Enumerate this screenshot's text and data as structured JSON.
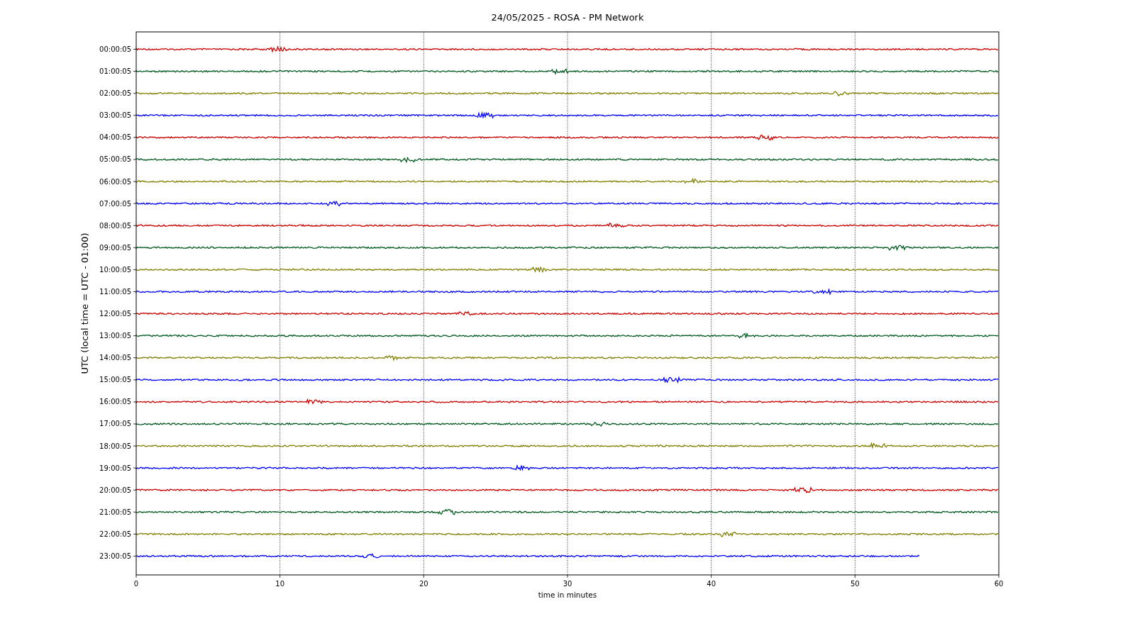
{
  "chart": {
    "title": "24/05/2025 - ROSA - PM Network",
    "ylabel": "UTC (local time = UTC - 01:00)",
    "xlabel": "time in minutes",
    "xticks": [
      "0",
      "10",
      "20",
      "30",
      "40",
      "50",
      "60"
    ],
    "rows": [
      {
        "label": "00:00:05",
        "color": "#cc0000",
        "level": 1
      },
      {
        "label": "01:00:05",
        "color": "#005a1e",
        "level": 1
      },
      {
        "label": "02:00:05",
        "color": "#808000",
        "level": 1
      },
      {
        "label": "03:00:05",
        "color": "#0000ff",
        "level": 1
      },
      {
        "label": "04:00:05",
        "color": "#cc0000",
        "level": 1
      },
      {
        "label": "05:00:05",
        "color": "#005a1e",
        "level": 1
      },
      {
        "label": "06:00:05",
        "color": "#808000",
        "level": 1
      },
      {
        "label": "07:00:05",
        "color": "#0000ff",
        "level": 1
      },
      {
        "label": "08:00:05",
        "color": "#cc0000",
        "level": 1
      },
      {
        "label": "09:00:05",
        "color": "#005a1e",
        "level": 1
      },
      {
        "label": "10:00:05",
        "color": "#808000",
        "level": 1
      },
      {
        "label": "11:00:05",
        "color": "#0000ff",
        "level": 1
      },
      {
        "label": "12:00:05",
        "color": "#cc0000",
        "level": 1
      },
      {
        "label": "13:00:05",
        "color": "#005a1e",
        "level": 1
      },
      {
        "label": "14:00:05",
        "color": "#808000",
        "level": 1
      },
      {
        "label": "15:00:05",
        "color": "#0000ff",
        "level": 1
      },
      {
        "label": "16:00:05",
        "color": "#cc0000",
        "level": 1
      },
      {
        "label": "17:00:05",
        "color": "#005a1e",
        "level": 1
      },
      {
        "label": "18:00:05",
        "color": "#808000",
        "level": 1
      },
      {
        "label": "19:00:05",
        "color": "#0000ff",
        "level": 1
      },
      {
        "label": "20:00:05",
        "color": "#cc0000",
        "level": 1
      },
      {
        "label": "21:00:05",
        "color": "#005a1e",
        "level": 1
      },
      {
        "label": "22:00:05",
        "color": "#808000",
        "level": 1
      },
      {
        "label": "23:00:05",
        "color": "#0000ff",
        "level": 0.908
      }
    ]
  }
}
